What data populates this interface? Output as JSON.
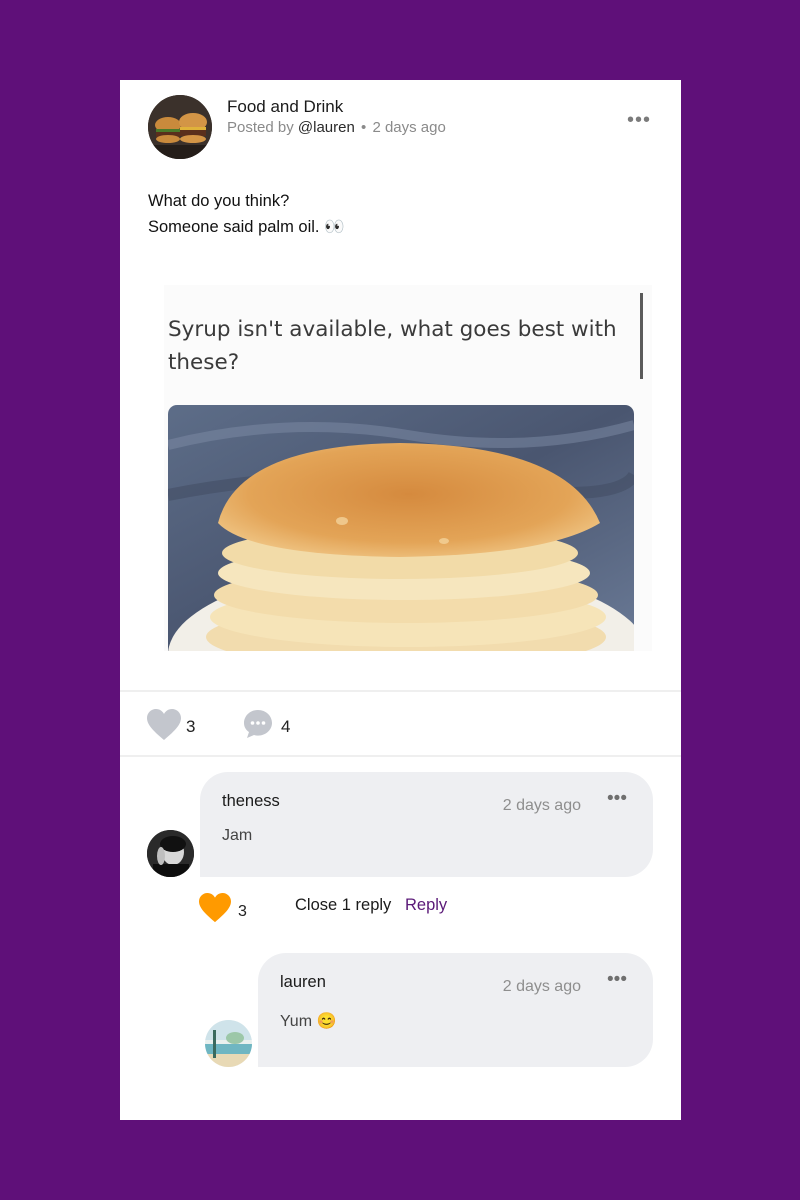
{
  "post": {
    "group_name": "Food and Drink",
    "posted_by_label": "Posted by",
    "author": "@lauren",
    "separator": "•",
    "time": "2 days ago",
    "more": "•••",
    "body_lines": [
      "What do you think?",
      "Someone said palm oil. 👀"
    ],
    "image_text": "Syrup isn't available, what goes best with these?",
    "like_count": "3",
    "comment_count": "4"
  },
  "comments": [
    {
      "author": "theness",
      "time": "2 days ago",
      "text": "Jam",
      "more": "•••",
      "like_count": "3",
      "close_label": "Close 1 reply",
      "reply_label": "Reply"
    },
    {
      "author": "lauren",
      "time": "2 days ago",
      "text": "Yum 😊",
      "more": "•••"
    }
  ],
  "colors": {
    "background": "#5f1079",
    "accent": "#5b1a78",
    "liked_heart": "#ff9a00",
    "inactive_icon": "#c3c6cd",
    "bubble": "#eeeff2"
  },
  "icons": {
    "like": "heart-icon",
    "comment": "comment-bubble-icon",
    "more": "more-dots-icon"
  }
}
